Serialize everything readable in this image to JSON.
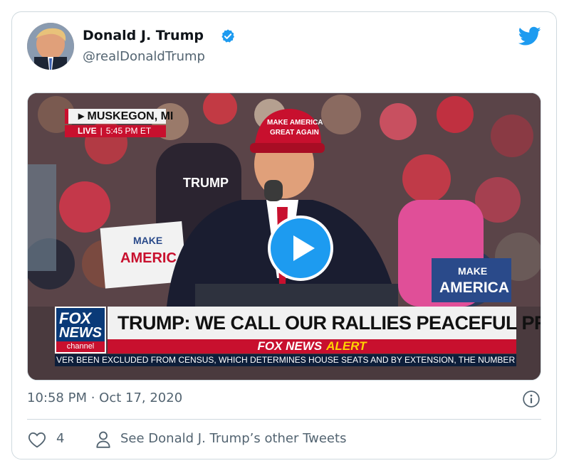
{
  "author": {
    "name": "Donald J. Trump",
    "handle": "@realDonaldTrump"
  },
  "media": {
    "location": "MUSKEGON, MI",
    "live_label": "LIVE",
    "live_time": "5:45 PM ET",
    "headline": "TRUMP: WE CALL OUR RALLIES PEACEFUL PROTESTS",
    "alert_brand": "FOX NEWS",
    "alert_word": "ALERT",
    "logo_line1": "FOX",
    "logo_line2": "NEWS",
    "logo_line3": "channel",
    "ticker": "VER BEEN EXCLUDED FROM CENSUS, WHICH DETERMINES HOUSE SEATS AND BY EXTENSION, THE NUMBER O",
    "hat_text_line1": "MAKE AMERICA",
    "hat_text_line2": "GREAT AGAIN",
    "sign1": "TRUMP",
    "sign2_line1": "MAKE",
    "sign2_line2": "AMERICA",
    "sign3_line1": "MAKE",
    "sign3_line2": "AMERICA"
  },
  "timestamp": "10:58 PM · Oct 17, 2020",
  "actions": {
    "like_count": "4",
    "other_tweets": "See Donald J. Trump’s other Tweets"
  },
  "colors": {
    "twitter_blue": "#1d9bf0",
    "fox_red": "#c8102e",
    "text_secondary": "#536471"
  },
  "icons": [
    "verified-badge-icon",
    "twitter-bird-icon",
    "play-icon",
    "info-icon",
    "heart-icon",
    "person-icon"
  ]
}
